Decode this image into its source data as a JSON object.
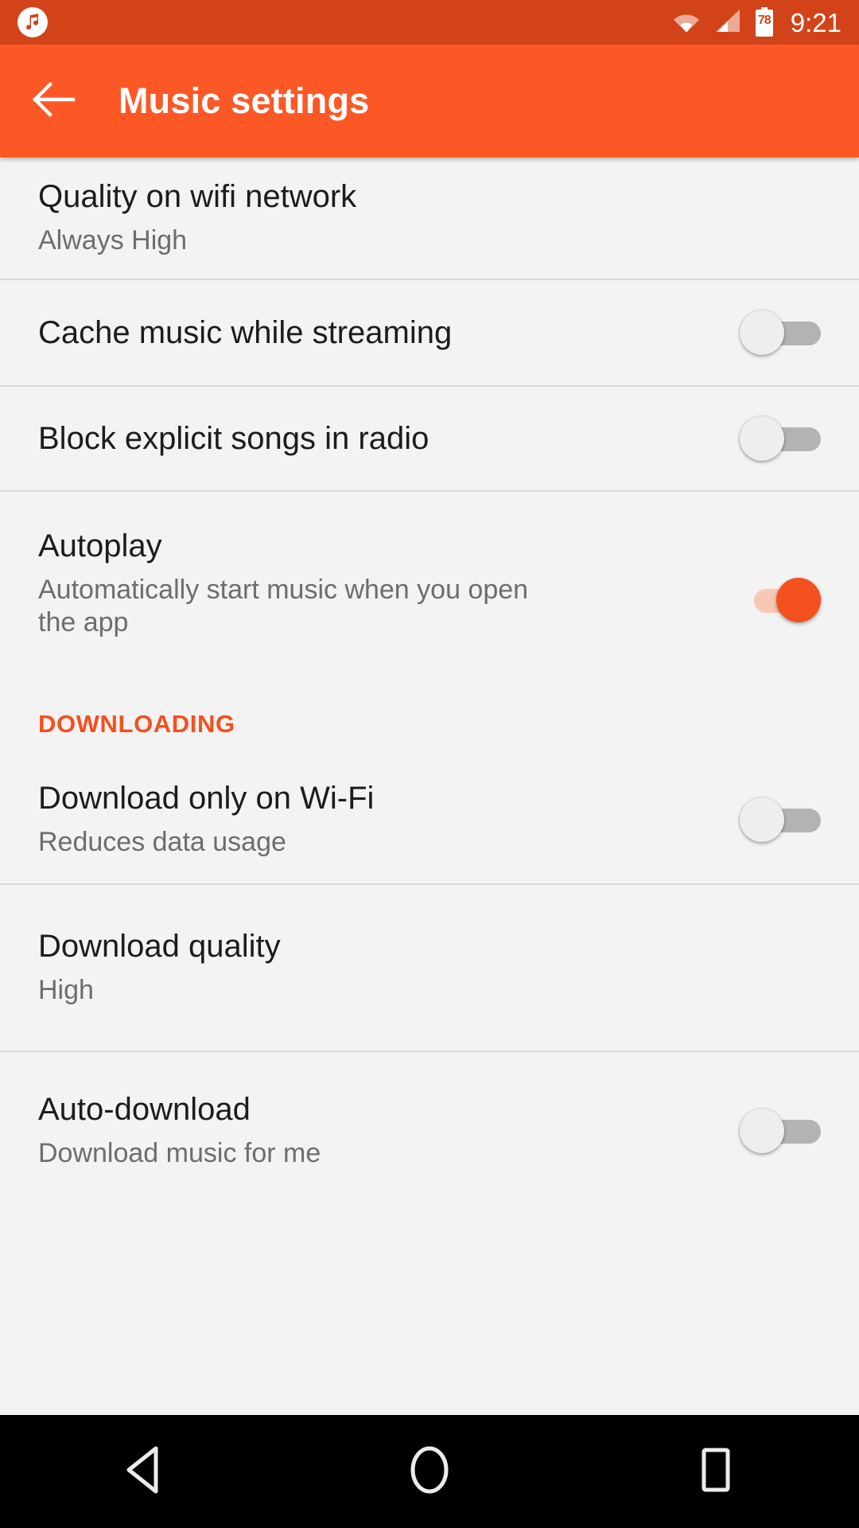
{
  "status_bar": {
    "app_icon": "music-note-icon",
    "wifi_icon": "wifi-icon",
    "signal_icon": "cellular-signal-icon",
    "battery_icon": "battery-icon",
    "battery_level": "78",
    "time": "9:21"
  },
  "app_bar": {
    "back_icon": "arrow-left-icon",
    "title": "Music settings"
  },
  "settings": {
    "items": [
      {
        "title": "Quality on wifi network",
        "subtitle": "Always High",
        "control": "none"
      },
      {
        "title": "Cache music while streaming",
        "subtitle": "",
        "control": "switch",
        "state": "off"
      },
      {
        "title": "Block explicit songs in radio",
        "subtitle": "",
        "control": "switch",
        "state": "off"
      },
      {
        "title": "Autoplay",
        "subtitle": "Automatically start music when you open the app",
        "control": "switch",
        "state": "on"
      }
    ],
    "downloading_header": "DOWNLOADING",
    "download_items": [
      {
        "title": "Download only on Wi-Fi",
        "subtitle": "Reduces data usage",
        "control": "switch",
        "state": "off"
      },
      {
        "title": "Download quality",
        "subtitle": "High",
        "control": "none"
      },
      {
        "title": "Auto-download",
        "subtitle": "Download music for me",
        "control": "switch",
        "state": "off"
      }
    ]
  },
  "nav_bar": {
    "back": "nav-back-icon",
    "home": "nav-home-icon",
    "recents": "nav-recents-icon"
  },
  "colors": {
    "status_bar": "#d2431a",
    "app_bar": "#fc5826",
    "accent": "#f4511e",
    "background": "#f3f3f3",
    "divider": "#d8d8d8",
    "switch_off_track": "#b3b3b3",
    "switch_on_track": "#f9c8b5"
  }
}
